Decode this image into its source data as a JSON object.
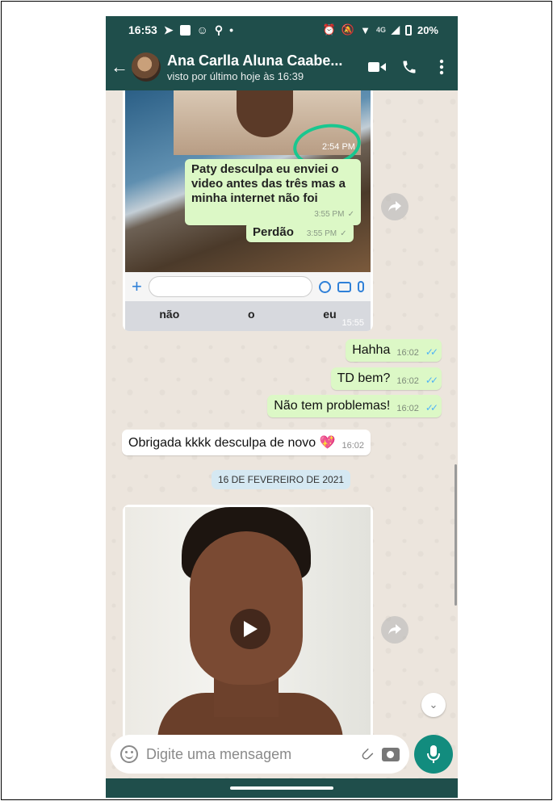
{
  "status_bar": {
    "time": "16:53",
    "network": "4G",
    "battery": "20%"
  },
  "header": {
    "contact_name": "Ana Carlla Aluna Caabe...",
    "last_seen": "visto por último hoje às 16:39"
  },
  "screenshot_message": {
    "inner_time": "2:54 PM",
    "messages": [
      {
        "text": "Paty desculpa eu enviei o video antes das três mas a minha internet não foi",
        "time": "3:55 PM"
      },
      {
        "text": "Perdão",
        "time": "3:55 PM"
      }
    ],
    "keyboard_suggestions": [
      "não",
      "o",
      "eu"
    ],
    "time": "15:55"
  },
  "messages": [
    {
      "dir": "out",
      "text": "Hahha",
      "time": "16:02"
    },
    {
      "dir": "out",
      "text": "TD bem?",
      "time": "16:02"
    },
    {
      "dir": "out",
      "text": "Não tem problemas!",
      "time": "16:02"
    },
    {
      "dir": "in",
      "text": "Obrigada kkkk desculpa de novo 💖",
      "time": "16:02"
    }
  ],
  "date_chip": "16 DE FEVEREIRO DE 2021",
  "composer": {
    "placeholder": "Digite uma mensagem"
  },
  "colors": {
    "header": "#1f4e4b",
    "outgoing_bubble": "#dcf8c6",
    "mic_button": "#128c7e",
    "chat_bg": "#ece5dd"
  }
}
